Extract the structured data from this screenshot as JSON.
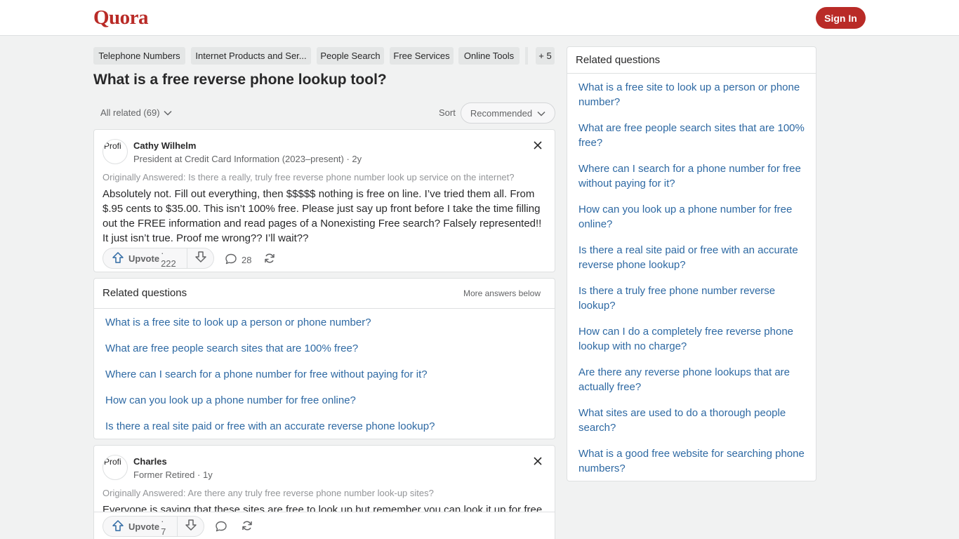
{
  "header": {
    "logo": "Quora",
    "signin_label": "Sign In"
  },
  "topics": [
    "Telephone Numbers",
    "Internet Products and Ser...",
    "People Search",
    "Free Services",
    "Online Tools"
  ],
  "topics_more": "+ 5",
  "question": {
    "title": "What is a free reverse phone lookup tool?"
  },
  "filter": {
    "all_related": "All related (69)",
    "sort_label": "Sort",
    "sort_value": "Recommended"
  },
  "answers": [
    {
      "avatar_alt": "Profi",
      "author": "Cathy Wilhelm",
      "credential": "President at Credit Card Information (2023–present) · 2y",
      "originally_answered": "Originally Answered: Is there a really, truly free reverse phone number look up service on the internet?",
      "text": "Absolutely not. Fill out everything, then $$$$$ nothing is free on line. I’ve tried them all. From $.95 cents to $35.00. This isn’t 100% free. Please just say up front before I take the time filling out the FREE information and read pages of a Nonexisting Free search? Falsely represented!! It just isn’t true. Proof me wrong?? I’ll wait??",
      "upvote_label": "Upvote",
      "upvote_count": "· 222",
      "comment_count": "28"
    },
    {
      "avatar_alt": "Profi",
      "author": "Charles",
      "credential": "Former Retired · 1y",
      "originally_answered": "Originally Answered: Are there any truly free reverse phone number look-up sites?",
      "text": "Everyone is saying that these sites are free to look up but remember you can look it up for free",
      "upvote_label": "Upvote",
      "upvote_count": "· 7",
      "comment_count": ""
    }
  ],
  "inline_related": {
    "title": "Related questions",
    "more_label": "More answers below",
    "links": [
      "What is a free site to look up a person or phone number?",
      "What are free people search sites that are 100% free?",
      "Where can I search for a phone number for free without paying for it?",
      "How can you look up a phone number for free online?",
      "Is there a real site paid or free with an accurate reverse phone lookup?"
    ]
  },
  "sidebar": {
    "title": "Related questions",
    "links": [
      "What is a free site to look up a person or phone number?",
      "What are free people search sites that are 100% free?",
      "Where can I search for a phone number for free without paying for it?",
      "How can you look up a phone number for free online?",
      "Is there a real site paid or free with an accurate reverse phone lookup?",
      "Is there a truly free phone number reverse lookup?",
      "How can I do a completely free reverse phone lookup with no charge?",
      "Are there any reverse phone lookups that are actually free?",
      "What sites are used to do a thorough people search?",
      "What is a good free website for searching phone numbers?"
    ]
  },
  "colors": {
    "brand": "#b92b27",
    "link": "#2e69a3",
    "upvote_icon": "#2e69a3"
  }
}
